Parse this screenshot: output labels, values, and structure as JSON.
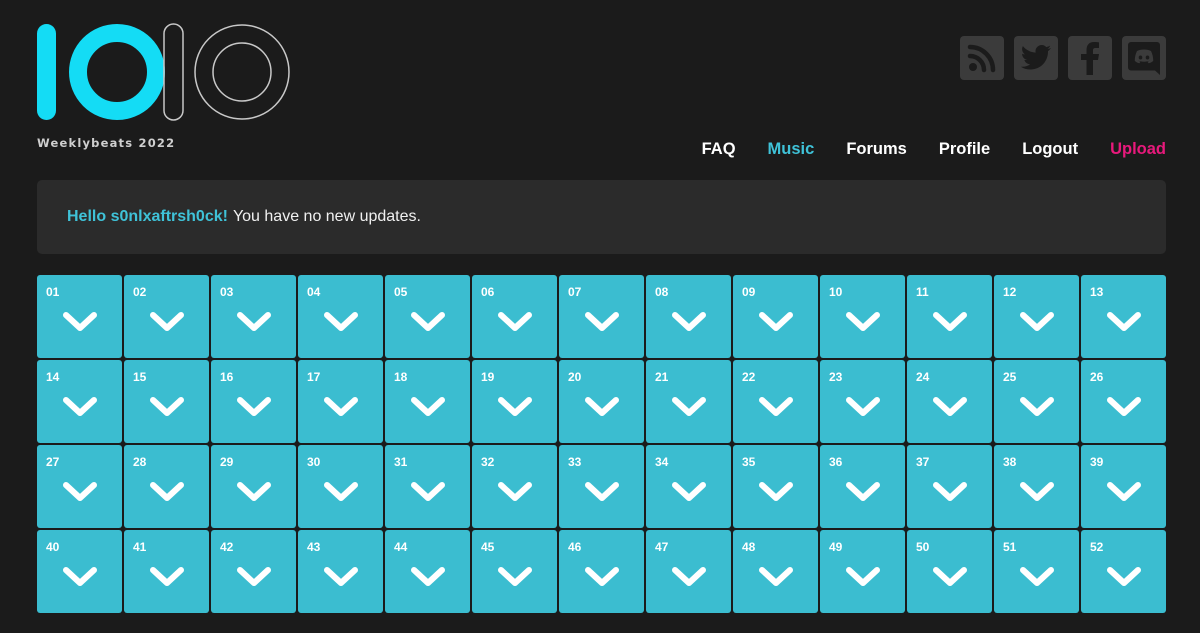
{
  "header": {
    "logo_text": "1010",
    "tagline": "Weeklybeats 2022",
    "colors": {
      "brand_cyan": "#14dcf5",
      "logo_outline": "#c8c8c8"
    },
    "social": [
      {
        "name": "rss-icon",
        "label": "RSS"
      },
      {
        "name": "twitter-icon",
        "label": "Twitter"
      },
      {
        "name": "facebook-icon",
        "label": "Facebook"
      },
      {
        "name": "discord-icon",
        "label": "Discord"
      }
    ]
  },
  "nav": {
    "items": [
      {
        "label": "FAQ"
      },
      {
        "label": "Music",
        "active": true
      },
      {
        "label": "Forums"
      },
      {
        "label": "Profile"
      },
      {
        "label": "Logout"
      },
      {
        "label": "Upload",
        "accent": "#e8197c"
      }
    ]
  },
  "notice": {
    "greeting": "Hello s0nlxaftrsh0ck!",
    "message": "You have no new updates."
  },
  "weeks": {
    "color": "#3bbdd0",
    "items": [
      "01",
      "02",
      "03",
      "04",
      "05",
      "06",
      "07",
      "08",
      "09",
      "10",
      "11",
      "12",
      "13",
      "14",
      "15",
      "16",
      "17",
      "18",
      "19",
      "20",
      "21",
      "22",
      "23",
      "24",
      "25",
      "26",
      "27",
      "28",
      "29",
      "30",
      "31",
      "32",
      "33",
      "34",
      "35",
      "36",
      "37",
      "38",
      "39",
      "40",
      "41",
      "42",
      "43",
      "44",
      "45",
      "46",
      "47",
      "48",
      "49",
      "50",
      "51",
      "52"
    ]
  }
}
